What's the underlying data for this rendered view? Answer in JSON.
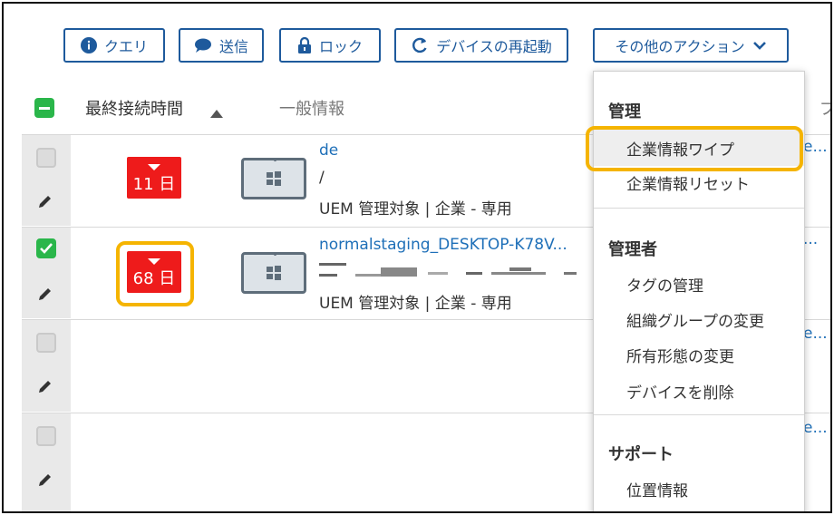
{
  "toolbar": {
    "query": "クエリ",
    "send": "送信",
    "lock": "ロック",
    "reboot": "デバイスの再起動",
    "more_actions": "その他のアクション"
  },
  "header": {
    "last_seen": "最終接続時間",
    "general_info": "一般情報",
    "partial_col": "プ"
  },
  "rows": [
    {
      "days": "11 日",
      "name": "de",
      "subtitle": "/",
      "management": "UEM 管理対象 | 企業 - 専用",
      "checked": false
    },
    {
      "days": "68 日",
      "name": "normalstaging_DESKTOP-K78V...",
      "management": "UEM 管理対象 | 企業 - 専用",
      "checked": true
    },
    {
      "checked": false
    },
    {
      "checked": false
    }
  ],
  "truncated_right": [
    "e...",
    "...",
    "e...",
    "e..."
  ],
  "menu": {
    "sec_manage": "管理",
    "wipe": "企業情報ワイプ",
    "reset": "企業情報リセット",
    "sec_admin": "管理者",
    "tags": "タグの管理",
    "org_change": "組織グループの変更",
    "ownership": "所有形態の変更",
    "delete": "デバイスを削除",
    "sec_support": "サポート",
    "location": "位置情報"
  },
  "colors": {
    "accent": "#1e5a9c",
    "danger": "#ee1b1b",
    "highlight": "#f5b400",
    "check": "#2ab64a"
  }
}
